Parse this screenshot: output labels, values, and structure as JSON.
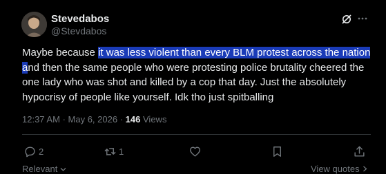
{
  "author": {
    "display_name": "Stevedabos",
    "handle": "@Stevdabos"
  },
  "post": {
    "text_before": "Maybe because ",
    "text_highlighted": "it was less violent than every BLM protest across the nation a",
    "text_after": "nd then the same people who were protesting police brutality cheered the one lady who was shot and killed by a cop that day. Just the absolutely hypocrisy of people like yourself. Idk tho just spitballing",
    "time": "12:37 AM",
    "separator": "·",
    "date": "May 6, 2026",
    "views_count": "146",
    "views_label": "Views"
  },
  "actions": {
    "replies": "2",
    "reposts": "1"
  },
  "footer": {
    "relevant_label": "Relevant",
    "view_quotes_label": "View quotes"
  },
  "icons": {
    "reply": "reply-icon",
    "repost": "repost-icon",
    "like": "heart-icon",
    "bookmark": "bookmark-icon",
    "share": "share-icon",
    "grok": "grok-icon",
    "more": "more-icon"
  },
  "colors": {
    "background": "#000000",
    "text": "#e7e9ea",
    "muted": "#71767b",
    "highlight": "#1a3bb8",
    "divider": "#2f3336"
  }
}
